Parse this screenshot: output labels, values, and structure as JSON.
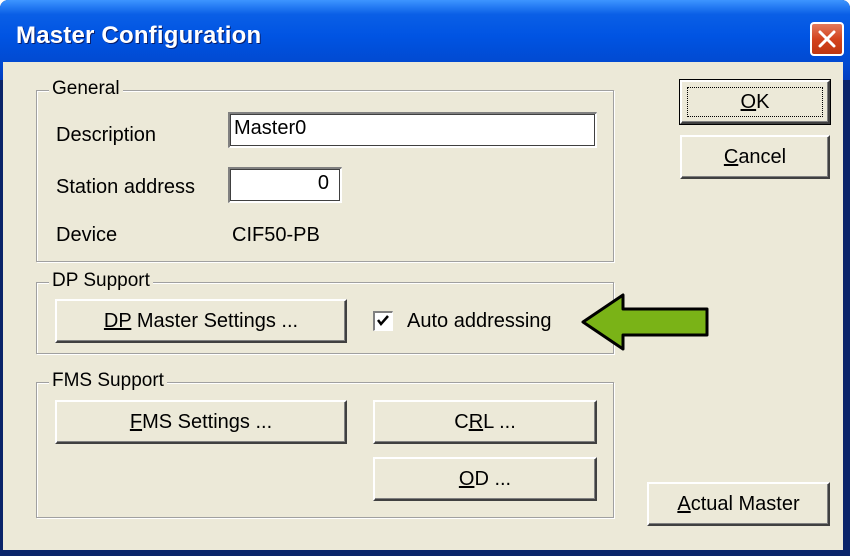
{
  "window": {
    "title": "Master Configuration"
  },
  "general": {
    "legend": "General",
    "description_label": "Description",
    "description_value": "Master0",
    "station_label": "Station address",
    "station_value": "0",
    "device_label": "Device",
    "device_value": "CIF50-PB"
  },
  "dp_support": {
    "legend": "DP Support",
    "settings_button_prefix": "DP",
    "settings_button_rest": " Master Settings ...",
    "auto_addressing_label": "Auto addressing",
    "auto_addressing_checked": true
  },
  "fms_support": {
    "legend": "FMS Support",
    "settings_button_u": "F",
    "settings_button_rest": "MS Settings ...",
    "crl_button_a": "C",
    "crl_button_u": "R",
    "crl_button_rest": "L ...",
    "od_button_u": "O",
    "od_button_rest": "D ..."
  },
  "buttons": {
    "ok_u": "O",
    "ok_rest": "K",
    "cancel_u": "C",
    "cancel_rest": "ancel",
    "actual_master_u": "A",
    "actual_master_rest": "ctual Master"
  },
  "colors": {
    "titlebar": "#0054e3",
    "dialog_bg": "#ece9d8",
    "arrow_fill": "#7ab317",
    "close_button": "#d4431d"
  },
  "icons": [
    "close-icon",
    "checkmark-icon",
    "left-arrow-icon"
  ]
}
